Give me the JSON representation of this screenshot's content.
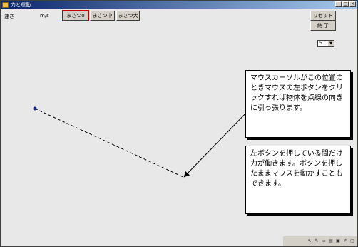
{
  "window": {
    "title": "力と運動"
  },
  "controls": {
    "speed_label": "速さ",
    "speed_unit": "m/s",
    "friction_buttons": [
      "まさつ0",
      "まさつ中",
      "まさつ大"
    ],
    "reset_label": "リセット",
    "quit_label": "終 了",
    "select_value": "5"
  },
  "callouts": {
    "top": "マウスカーソルがこの位置のときマウスの左ボタンをクリックすれば物体を点線の向きに引っ張ります。",
    "bottom": "左ボタンを押している間だけ力が働きます。ボタンを押したままマウスを動かすこともできます。"
  },
  "colors": {
    "object": "#1a237e",
    "active_outline": "#c00000"
  },
  "tray_icons": [
    "cursor-icon",
    "pen-icon",
    "folder-icon",
    "printer-icon",
    "save-icon",
    "edit-icon",
    "window-icon"
  ]
}
